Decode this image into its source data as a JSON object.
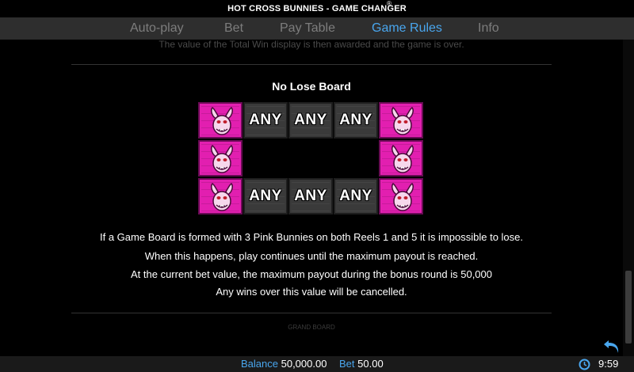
{
  "app": {
    "title": "HOT CROSS BUNNIES - GAME CHANGER",
    "registered_mark": "®"
  },
  "nav": {
    "tabs": [
      {
        "label": "Auto-play",
        "active": false
      },
      {
        "label": "Bet",
        "active": false
      },
      {
        "label": "Pay Table",
        "active": false
      },
      {
        "label": "Game Rules",
        "active": true
      },
      {
        "label": "Info",
        "active": false
      }
    ]
  },
  "content": {
    "faded_top_text": "The value of the Total Win display is then awarded and the game is over.",
    "heading": "No Lose Board",
    "board": {
      "rows": [
        [
          "bunny",
          "any",
          "any",
          "any",
          "bunny"
        ],
        [
          "bunny",
          "",
          "",
          "",
          "bunny"
        ],
        [
          "bunny",
          "any",
          "any",
          "any",
          "bunny"
        ]
      ],
      "any_label": "ANY"
    },
    "paragraphs": [
      "If a Game Board is formed with 3 Pink Bunnies on both Reels 1 and 5 it is impossible to lose.",
      "When this happens, play continues until the maximum payout is reached.",
      "At the current bet value, the maximum payout during the bonus round is 50,000",
      "Any wins over this value will be cancelled."
    ],
    "faded_bottom_text": "GRAND BOARD"
  },
  "footer": {
    "balance_label": "Balance",
    "balance_value": "50,000.00",
    "bet_label": "Bet",
    "bet_value": "50.00",
    "time": "9:59"
  },
  "colors": {
    "accent": "#49a6ee",
    "bunny_tile": "#e21fb0",
    "any_tile": "#3a3a3a",
    "nav_bg": "#2e2e2e"
  },
  "icons": {
    "back": "undo-arrow-icon",
    "clock": "clock-icon",
    "bunny": "pink-bunny-icon"
  }
}
